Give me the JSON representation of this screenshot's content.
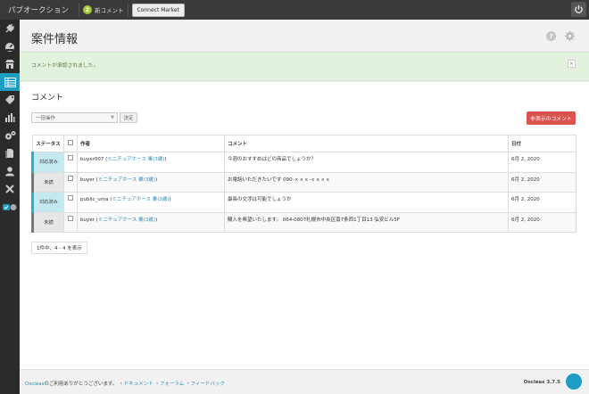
{
  "topbar": {
    "app_title": "パブオークション",
    "badge_count": "2",
    "badge_label": "新コメント",
    "connect_label": "Connect Market"
  },
  "sidebar": {
    "items": [
      {
        "icon": "plug-icon"
      },
      {
        "icon": "gauge-icon"
      },
      {
        "icon": "shop-icon"
      },
      {
        "icon": "table-icon",
        "active": true
      },
      {
        "icon": "tag-icon"
      },
      {
        "icon": "bar-chart-icon"
      },
      {
        "icon": "gears-icon"
      },
      {
        "icon": "pages-icon"
      },
      {
        "icon": "user-icon"
      },
      {
        "icon": "wrench-icon"
      },
      {
        "icon": "toggle-icon"
      }
    ]
  },
  "header": {
    "title": "案件情報"
  },
  "notice": {
    "text": "コメントが承認されました。",
    "close": "×"
  },
  "main": {
    "section_title": "コメント",
    "bulk_select": "一括操作",
    "bulk_apply": "決定",
    "hidden_button": "非表示のコメント",
    "columns": {
      "status": "ステータス",
      "author": "作者",
      "comment": "コメント",
      "date": "日付"
    },
    "rows": [
      {
        "status": "対応済み",
        "author_name": "buyer007",
        "author_link": "ミニチュアホース 乗(3歳)",
        "comment": "今週のおすすめはどの商品でしょうか？",
        "date": "6月 2, 2020"
      },
      {
        "status": "未読",
        "author_name": "buyer",
        "author_link": "ミニチュアホース 乗(3歳)",
        "comment": "お電話いただきたいです 090-ｘｘｘ-ｘｘｘｘ",
        "date": "6月 2, 2020"
      },
      {
        "status": "対応済み",
        "author_name": "public_uma",
        "author_link": "ミニチュアホース 乗(3歳)",
        "comment": "最長の交渉は可能でしょうか",
        "date": "6月 2, 2020"
      },
      {
        "status": "未読",
        "author_name": "buyer",
        "author_link": "ミニチュアホース 乗(3歳)",
        "comment": "購入を希望いたします。 064-0807札幌市中央区南7条西1丁目13 弘安ビル5F",
        "date": "6月 2, 2020"
      }
    ],
    "pager": "1件中、4 - 4 を表示"
  },
  "footer": {
    "brand": "Oscleas",
    "text": "のご利用ありがとうございます。",
    "link1": "ドキュメント",
    "link2": "フォーラム",
    "link3": "フィードバック",
    "version": "Oscleas 3.7.5",
    "sep": "・"
  }
}
